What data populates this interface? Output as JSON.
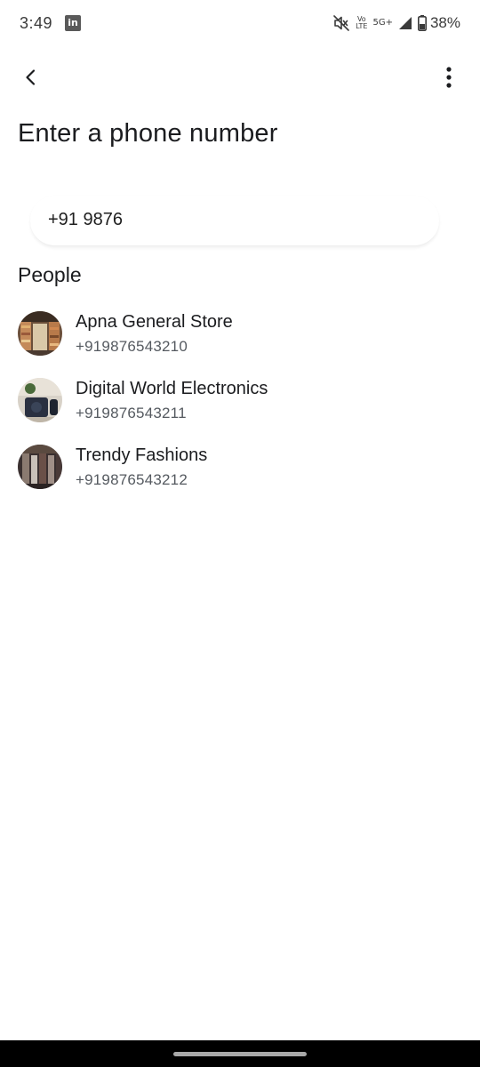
{
  "status_bar": {
    "time": "3:49",
    "notification_app": "in",
    "volte_top": "Vo",
    "volte_bottom": "LTE",
    "network": "5G+",
    "battery": "38%"
  },
  "header": {
    "back_icon": "back-arrow-icon",
    "more_icon": "more-vertical-icon"
  },
  "page": {
    "title": "Enter a phone number"
  },
  "phone_input": {
    "value": "+91 9876"
  },
  "people": {
    "section_title": "People",
    "contacts": [
      {
        "name": "Apna General Store",
        "number": "+919876543210",
        "avatar_icon": "store-photo-avatar"
      },
      {
        "name": "Digital World Electronics",
        "number": "+919876543211",
        "avatar_icon": "electronics-photo-avatar"
      },
      {
        "name": "Trendy Fashions",
        "number": "+919876543212",
        "avatar_icon": "fashion-photo-avatar"
      }
    ]
  },
  "colors": {
    "text_primary": "#1b1c1f",
    "text_secondary": "#555a60",
    "background": "#ffffff",
    "nav_bar": "#000000"
  }
}
